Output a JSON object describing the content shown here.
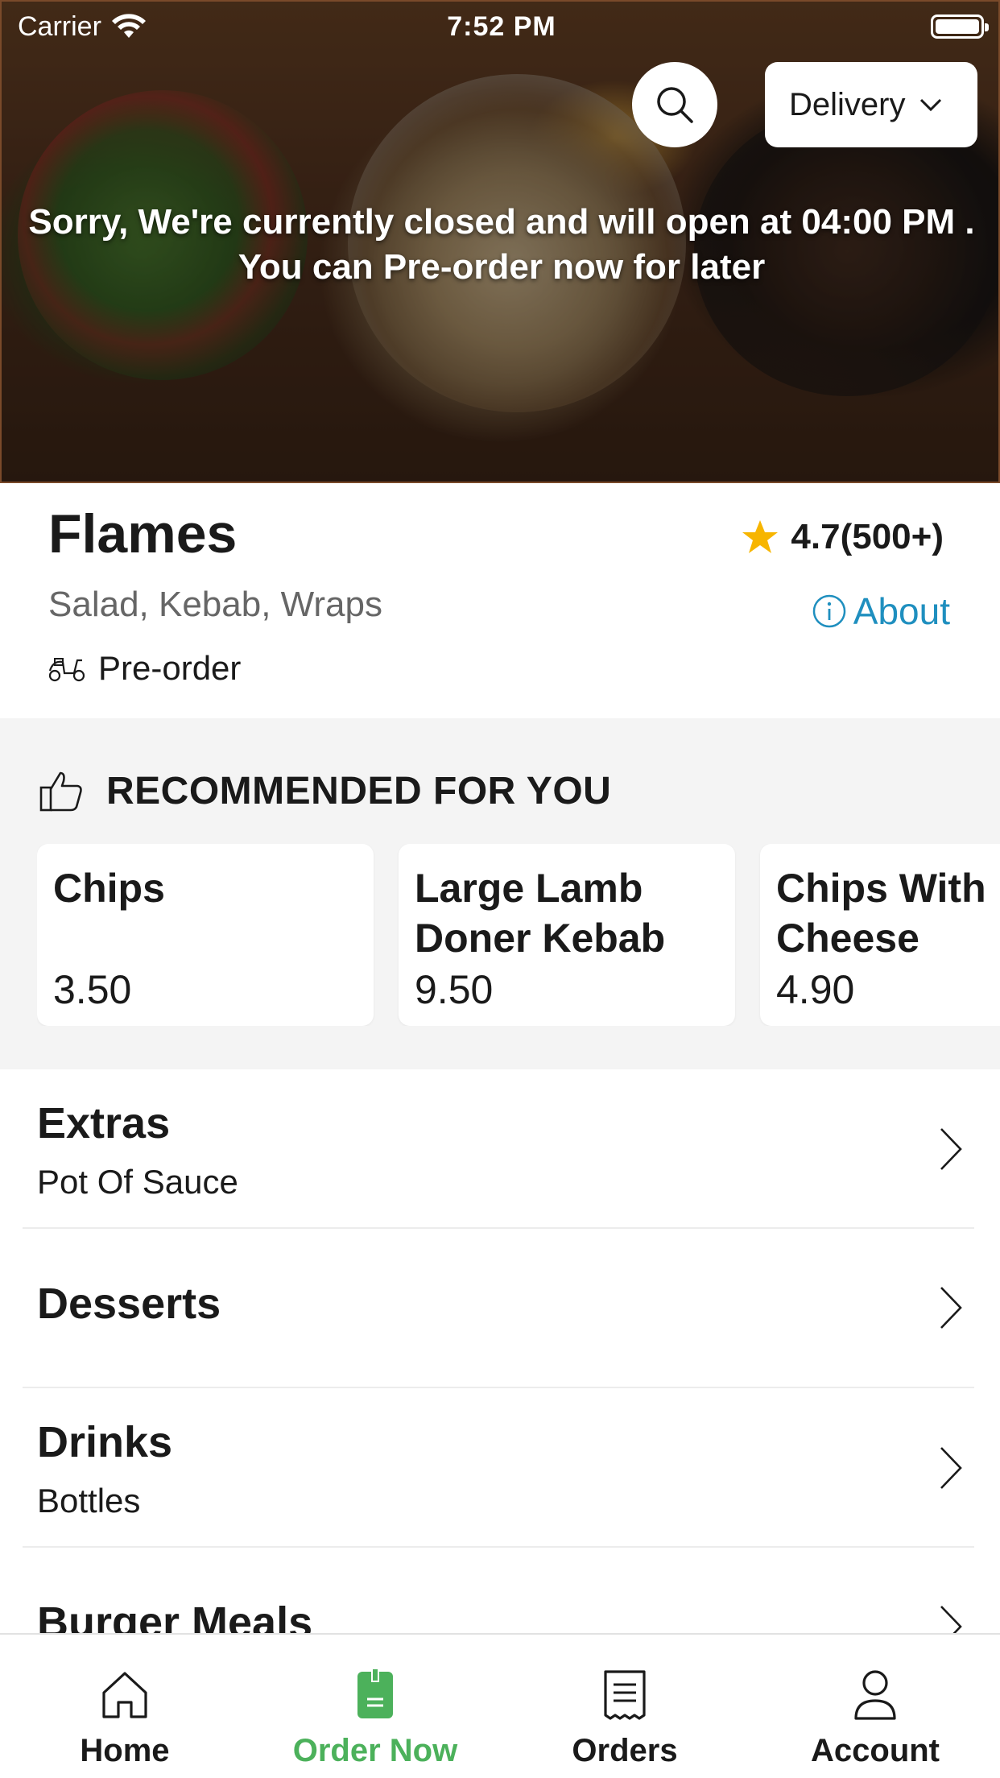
{
  "status_bar": {
    "carrier": "Carrier",
    "time": "7:52 PM"
  },
  "header": {
    "search_icon": "search-icon",
    "order_mode": "Delivery",
    "closed_message_line1": "Sorry, We're currently closed and will open at 04:00 PM .",
    "closed_message_line2": "You can Pre-order now for later"
  },
  "restaurant": {
    "name": "Flames",
    "rating": "4.7(500+)",
    "cuisines": "Salad, Kebab, Wraps",
    "about_label": "About",
    "preorder_label": "Pre-order"
  },
  "recommended": {
    "title": "RECOMMENDED FOR YOU",
    "items": [
      {
        "name": "Chips",
        "price": "3.50"
      },
      {
        "name": "Large Lamb Doner Kebab",
        "price": "9.50"
      },
      {
        "name": "Chips With Cheese",
        "price": "4.90"
      }
    ]
  },
  "categories": [
    {
      "title": "Extras",
      "subtitle": "Pot Of Sauce"
    },
    {
      "title": "Desserts",
      "subtitle": ""
    },
    {
      "title": "Drinks",
      "subtitle": "Bottles"
    },
    {
      "title": "Burger Meals",
      "subtitle": ""
    }
  ],
  "tabbar": {
    "tabs": [
      {
        "label": "Home",
        "icon": "home-icon"
      },
      {
        "label": "Order Now",
        "icon": "menu-book-icon"
      },
      {
        "label": "Orders",
        "icon": "receipt-icon"
      },
      {
        "label": "Account",
        "icon": "user-icon"
      }
    ],
    "active_index": 1
  },
  "colors": {
    "accent_green": "#4cb15b",
    "link_blue": "#1f8fbf",
    "star_yellow": "#f7b500"
  }
}
